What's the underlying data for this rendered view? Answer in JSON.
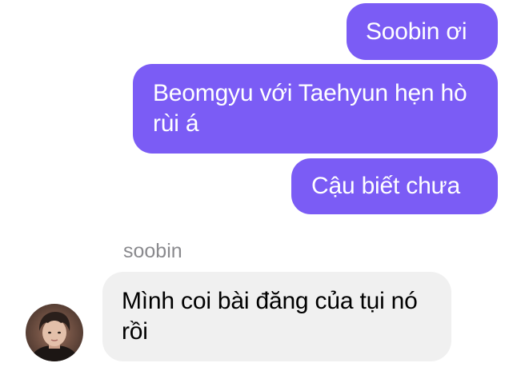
{
  "thread": {
    "outgoing": [
      {
        "text": "Soobin ơi"
      },
      {
        "text": "Beomgyu với Taehyun hẹn hò rùi á"
      },
      {
        "text": "Cậu biết chưa"
      }
    ],
    "incoming": {
      "sender": "soobin",
      "messages": [
        {
          "text": "Mình coi bài đăng của tụi nó rồi"
        }
      ]
    }
  },
  "colors": {
    "outgoing_bubble": "#7b5cf5",
    "incoming_bubble": "#f0f0f0",
    "sender_name": "#8a8a8e"
  },
  "icons": {
    "avatar": "profile-photo"
  }
}
